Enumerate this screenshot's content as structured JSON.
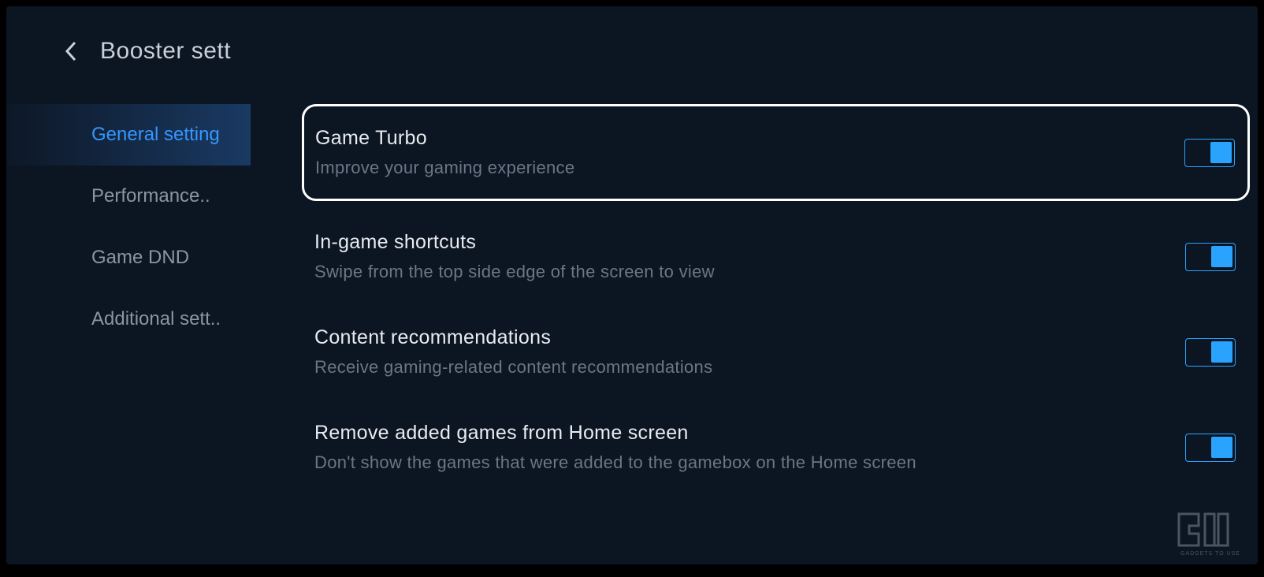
{
  "header": {
    "title": "Booster sett"
  },
  "sidebar": {
    "items": [
      {
        "label": "General setting",
        "active": true
      },
      {
        "label": "Performance..",
        "active": false
      },
      {
        "label": "Game DND",
        "active": false
      },
      {
        "label": "Additional sett..",
        "active": false
      }
    ]
  },
  "settings": [
    {
      "title": "Game Turbo",
      "description": "Improve your gaming experience",
      "enabled": true,
      "highlighted": true
    },
    {
      "title": "In-game shortcuts",
      "description": "Swipe from the top side edge of the screen to view",
      "enabled": true,
      "highlighted": false
    },
    {
      "title": "Content recommendations",
      "description": "Receive gaming-related content recommendations",
      "enabled": true,
      "highlighted": false
    },
    {
      "title": "Remove added games from Home screen",
      "description": "Don't show the games that were added to the gamebox on the Home screen",
      "enabled": true,
      "highlighted": false
    }
  ],
  "watermark": {
    "text": "GADGETS TO USE"
  }
}
